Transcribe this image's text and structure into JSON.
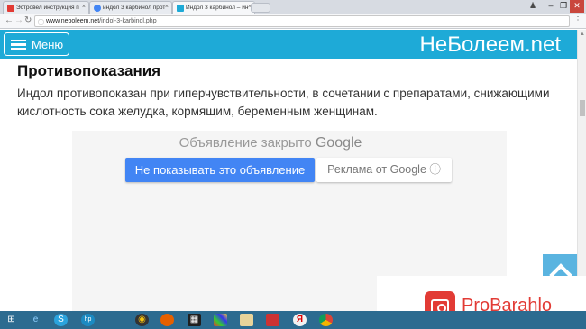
{
  "browser": {
    "tabs": [
      {
        "label": "Эстровел инструкция п",
        "favicon": "site-favicon",
        "color": "#e23b35",
        "active": false
      },
      {
        "label": "индол 3 карбинол прот",
        "favicon": "google-favicon",
        "color": "#4285f4",
        "active": false
      },
      {
        "label": "Индол 3 карбинол – ин",
        "favicon": "site-favicon",
        "color": "#1eaad7",
        "active": true
      }
    ],
    "close_glyph": "×",
    "url_host": "www.neboleem.net",
    "url_path": "/indol-3-karbinol.php",
    "window_controls": [
      "–",
      "❐",
      "✕"
    ]
  },
  "site": {
    "menu_label": "Меню",
    "logo": "НеБолеем.net",
    "accent_color": "#1eaad7"
  },
  "content": {
    "section_title": "Противопоказания",
    "section_text": "Индол противопоказан при гиперчувствительности, в сочетании с препаратами, снижающими кислотность сока желудка, кормящим, беременным женщинам."
  },
  "ad": {
    "closed_text": "Объявление закрыто",
    "google_label": "Google",
    "hide_button": "Не показывать это объявление",
    "why_button": "Реклама от Google ⓘ"
  },
  "watermark": {
    "text": "ProBarahlo",
    "color": "#e23b35"
  },
  "taskbar": {
    "icons": [
      "windows-start-icon",
      "ie-icon",
      "skype-icon",
      "hp-icon",
      "game-icon",
      "firefox-icon",
      "media-icon",
      "photos-icon",
      "files-icon",
      "pdf-icon",
      "yandex-icon",
      "chrome-icon"
    ]
  }
}
